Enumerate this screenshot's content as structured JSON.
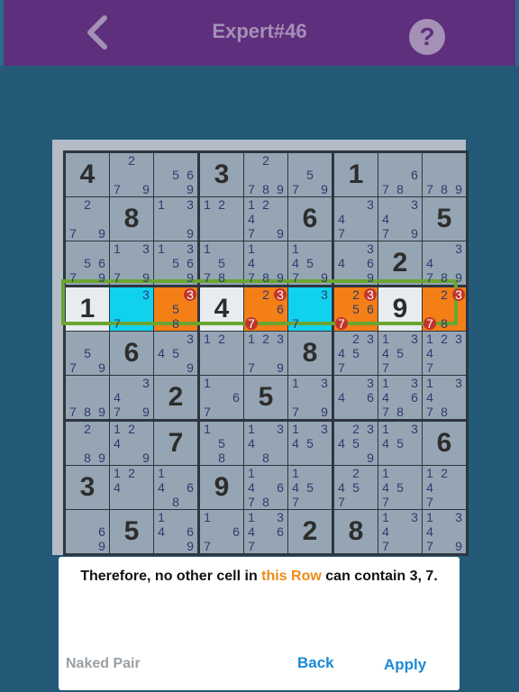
{
  "header": {
    "title": "Expert#46",
    "help_label": "?"
  },
  "colors": {
    "top_bar": "#5e2f7d",
    "background": "#245a78",
    "cyan": "#10d2ee",
    "orange": "#f47f16",
    "highlight_border": "#6aa531",
    "eliminated": "#c0352b"
  },
  "board": {
    "grid": [
      [
        {
          "v": 4
        },
        {
          "c": [
            2,
            7,
            9
          ]
        },
        {
          "c": [
            5,
            6,
            9
          ]
        },
        {
          "v": 3
        },
        {
          "c": [
            2,
            7,
            8,
            9
          ]
        },
        {
          "c": [
            5,
            7,
            9
          ]
        },
        {
          "v": 1
        },
        {
          "c": [
            6,
            7,
            8
          ]
        },
        {
          "c": [
            7,
            8,
            9
          ]
        }
      ],
      [
        {
          "c": [
            2,
            7,
            9
          ]
        },
        {
          "v": 8
        },
        {
          "c": [
            1,
            3,
            9
          ]
        },
        {
          "c": [
            1,
            2
          ]
        },
        {
          "c": [
            1,
            2,
            4,
            7,
            9
          ]
        },
        {
          "v": 6
        },
        {
          "c": [
            3,
            4,
            7
          ]
        },
        {
          "c": [
            3,
            4,
            7,
            9
          ]
        },
        {
          "v": 5
        }
      ],
      [
        {
          "c": [
            5,
            6,
            7,
            9
          ]
        },
        {
          "c": [
            1,
            3,
            7,
            9
          ]
        },
        {
          "c": [
            1,
            3,
            5,
            6,
            9
          ]
        },
        {
          "c": [
            1,
            5,
            7,
            8
          ]
        },
        {
          "c": [
            1,
            4,
            7,
            8,
            9
          ]
        },
        {
          "c": [
            1,
            4,
            5,
            7,
            9
          ]
        },
        {
          "c": [
            3,
            4,
            6,
            9
          ]
        },
        {
          "v": 2
        },
        {
          "c": [
            3,
            4,
            7,
            8,
            9
          ]
        }
      ],
      [
        {
          "v": 1,
          "bg": "white"
        },
        {
          "c": [
            3,
            7
          ],
          "bg": "cyan"
        },
        {
          "c": [
            3,
            5,
            8
          ],
          "bg": "orange",
          "x": [
            3
          ]
        },
        {
          "v": 4,
          "bg": "white"
        },
        {
          "c": [
            2,
            3,
            6,
            7
          ],
          "bg": "orange",
          "x": [
            3,
            7
          ]
        },
        {
          "c": [
            3,
            7
          ],
          "bg": "cyan"
        },
        {
          "c": [
            2,
            3,
            5,
            6,
            7
          ],
          "bg": "orange",
          "x": [
            3,
            7
          ]
        },
        {
          "v": 9,
          "bg": "white"
        },
        {
          "c": [
            2,
            3,
            7,
            8
          ],
          "bg": "orange",
          "x": [
            3,
            7
          ]
        }
      ],
      [
        {
          "c": [
            5,
            7,
            9
          ]
        },
        {
          "v": 6
        },
        {
          "c": [
            3,
            4,
            5,
            9
          ]
        },
        {
          "c": [
            1,
            2
          ]
        },
        {
          "c": [
            1,
            2,
            3,
            7,
            9
          ]
        },
        {
          "v": 8
        },
        {
          "c": [
            2,
            3,
            4,
            5,
            7
          ]
        },
        {
          "c": [
            1,
            3,
            4,
            5,
            7
          ]
        },
        {
          "c": [
            1,
            2,
            3,
            4,
            7
          ]
        }
      ],
      [
        {
          "c": [
            7,
            8,
            9
          ]
        },
        {
          "c": [
            3,
            4,
            7,
            9
          ]
        },
        {
          "v": 2
        },
        {
          "c": [
            1,
            6,
            7
          ]
        },
        {
          "v": 5
        },
        {
          "c": [
            1,
            3,
            7,
            9
          ]
        },
        {
          "c": [
            3,
            4,
            6
          ]
        },
        {
          "c": [
            1,
            3,
            4,
            6,
            7,
            8
          ]
        },
        {
          "c": [
            1,
            3,
            4,
            7,
            8
          ]
        }
      ],
      [
        {
          "c": [
            2,
            8,
            9
          ]
        },
        {
          "c": [
            1,
            2,
            4,
            9
          ]
        },
        {
          "v": 7
        },
        {
          "c": [
            1,
            5,
            8
          ]
        },
        {
          "c": [
            1,
            3,
            4,
            8
          ]
        },
        {
          "c": [
            1,
            3,
            4,
            5
          ]
        },
        {
          "c": [
            2,
            3,
            4,
            5,
            9
          ]
        },
        {
          "c": [
            1,
            3,
            4,
            5
          ]
        },
        {
          "v": 6
        }
      ],
      [
        {
          "v": 3
        },
        {
          "c": [
            1,
            2,
            4
          ]
        },
        {
          "c": [
            1,
            4,
            6,
            8
          ]
        },
        {
          "v": 9
        },
        {
          "c": [
            1,
            4,
            6,
            7,
            8
          ]
        },
        {
          "c": [
            1,
            4,
            5,
            7
          ]
        },
        {
          "c": [
            2,
            4,
            5,
            7
          ]
        },
        {
          "c": [
            1,
            4,
            5,
            7
          ]
        },
        {
          "c": [
            1,
            2,
            4,
            7
          ]
        }
      ],
      [
        {
          "c": [
            6,
            9
          ]
        },
        {
          "v": 5
        },
        {
          "c": [
            1,
            4,
            6,
            9
          ]
        },
        {
          "c": [
            1,
            6,
            7
          ]
        },
        {
          "c": [
            1,
            3,
            4,
            6,
            7
          ]
        },
        {
          "v": 2
        },
        {
          "v": 8
        },
        {
          "c": [
            1,
            3,
            4,
            7
          ]
        },
        {
          "c": [
            1,
            3,
            4,
            7,
            9
          ]
        }
      ]
    ]
  },
  "hint": {
    "message_prefix": "Therefore, no other cell in ",
    "message_highlight": "this Row",
    "message_suffix": " can contain 3, 7.",
    "technique": "Naked Pair",
    "back_label": "Back",
    "apply_label": "Apply"
  }
}
